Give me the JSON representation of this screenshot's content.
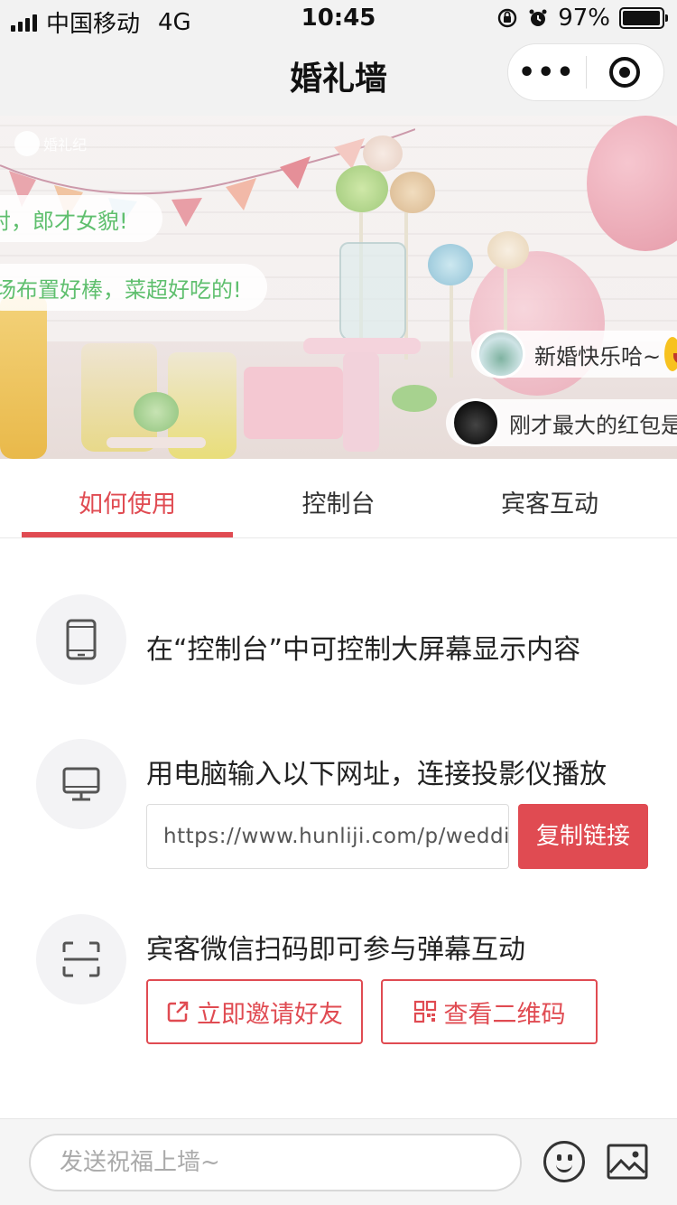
{
  "status_bar": {
    "carrier": "中国移动",
    "network": "4G",
    "time": "10:45",
    "battery": "97%",
    "battery_level": 0.97
  },
  "nav": {
    "title": "婚礼墙"
  },
  "banner": {
    "danmaku": [
      {
        "text": "对，郎才女貌!"
      },
      {
        "text": "场布置好棒，菜超好吃的!"
      },
      {
        "text": "新婚快乐哈~"
      },
      {
        "text": "刚才最大的红包是"
      }
    ]
  },
  "tabs": [
    {
      "label": "如何使用",
      "active": true
    },
    {
      "label": "控制台",
      "active": false
    },
    {
      "label": "宾客互动",
      "active": false
    }
  ],
  "rows": {
    "console_tip": "在“控制台”中可控制大屏幕显示内容",
    "pc_tip": "用电脑输入以下网址，连接投影仪播放",
    "url": "https://www.hunliji.com/p/wedding",
    "copy_button": "复制链接",
    "guest_tip": "宾客微信扫码即可参与弹幕互动",
    "invite_button": "立即邀请好友",
    "qrcode_button": "查看二维码"
  },
  "bottom_bar": {
    "input_placeholder": "发送祝福上墙~"
  },
  "colors": {
    "accent": "#e04b52",
    "danmaku_green": "#5fbf6e"
  },
  "icons": [
    "signal-icon",
    "orientation-lock-icon",
    "alarm-icon",
    "battery-icon",
    "more-icon",
    "target-icon",
    "phone-icon",
    "monitor-icon",
    "scan-icon",
    "share-icon",
    "qrcode-icon",
    "emoji-icon",
    "image-icon"
  ]
}
